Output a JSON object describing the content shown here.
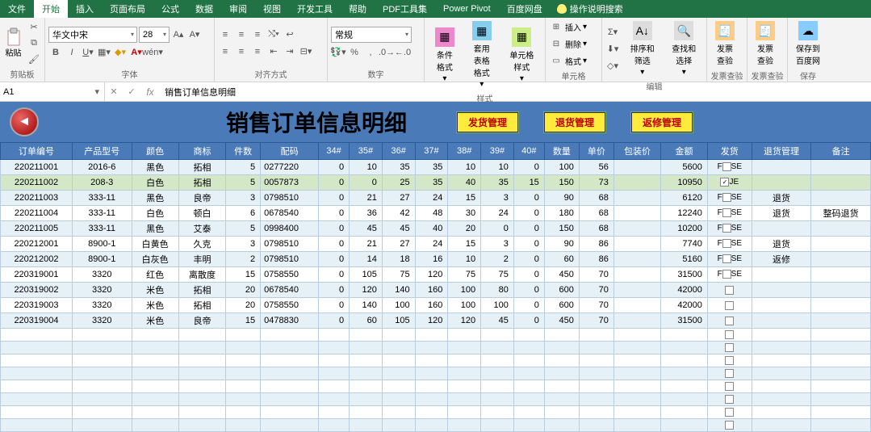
{
  "tabs": [
    "文件",
    "开始",
    "插入",
    "页面布局",
    "公式",
    "数据",
    "审阅",
    "视图",
    "开发工具",
    "帮助",
    "PDF工具集",
    "Power Pivot",
    "百度网盘"
  ],
  "active_tab": 1,
  "tellme": "操作说明搜索",
  "ribbon": {
    "clipboard": {
      "label": "剪贴板",
      "paste": "粘贴"
    },
    "font": {
      "label": "字体",
      "name": "华文中宋",
      "size": "28"
    },
    "align": {
      "label": "对齐方式"
    },
    "number": {
      "label": "数字",
      "format": "常规"
    },
    "styles": {
      "label": "样式",
      "cond": "条件格式",
      "table": "套用\n表格格式",
      "cell": "单元格样式"
    },
    "cells": {
      "label": "单元格",
      "insert": "插入",
      "delete": "删除",
      "format": "格式"
    },
    "editing": {
      "label": "编辑",
      "sort": "排序和筛选",
      "find": "查找和选择"
    },
    "fpcheck1": {
      "label": "发票查验",
      "btn": "发票\n查验"
    },
    "fpcheck2": {
      "label": "发票查验",
      "btn": "发票\n查验"
    },
    "save": {
      "label": "保存",
      "btn": "保存到\n百度网"
    }
  },
  "namebox": "A1",
  "formula": "销售订单信息明细",
  "title_big": "销售订单信息明细",
  "buttons": {
    "ship": "发货管理",
    "return": "退货管理",
    "repair": "返修管理"
  },
  "cols": [
    "订单编号",
    "产品型号",
    "颜色",
    "商标",
    "件数",
    "配码",
    "34#",
    "35#",
    "36#",
    "37#",
    "38#",
    "39#",
    "40#",
    "数量",
    "单价",
    "包装价",
    "金额",
    "发货",
    "退货管理",
    "备注"
  ],
  "selected_row_index": 1,
  "rows": [
    {
      "d": [
        "220211001",
        "2016-6",
        "黑色",
        "拓相",
        "5",
        "0277220",
        "0",
        "10",
        "35",
        "35",
        "10",
        "10",
        "0",
        "100",
        "56",
        "",
        "5600"
      ],
      "ship": "FALSE",
      "rg": "",
      "bz": ""
    },
    {
      "d": [
        "220211002",
        "208-3",
        "白色",
        "拓相",
        "5",
        "0057873",
        "0",
        "0",
        "25",
        "35",
        "40",
        "35",
        "15",
        "150",
        "73",
        "",
        "10950"
      ],
      "ship": "TRUE",
      "rg": "",
      "bz": ""
    },
    {
      "d": [
        "220211003",
        "333-11",
        "黑色",
        "良帝",
        "3",
        "0798510",
        "0",
        "21",
        "27",
        "24",
        "15",
        "3",
        "0",
        "90",
        "68",
        "",
        "6120"
      ],
      "ship": "FALSE",
      "rg": "退货",
      "bz": ""
    },
    {
      "d": [
        "220211004",
        "333-11",
        "白色",
        "顿白",
        "6",
        "0678540",
        "0",
        "36",
        "42",
        "48",
        "30",
        "24",
        "0",
        "180",
        "68",
        "",
        "12240"
      ],
      "ship": "FALSE",
      "rg": "退货",
      "bz": "整码退货"
    },
    {
      "d": [
        "220211005",
        "333-11",
        "黑色",
        "艾泰",
        "5",
        "0998400",
        "0",
        "45",
        "45",
        "40",
        "20",
        "0",
        "0",
        "150",
        "68",
        "",
        "10200"
      ],
      "ship": "FALSE",
      "rg": "",
      "bz": ""
    },
    {
      "d": [
        "220212001",
        "8900-1",
        "白黄色",
        "久克",
        "3",
        "0798510",
        "0",
        "21",
        "27",
        "24",
        "15",
        "3",
        "0",
        "90",
        "86",
        "",
        "7740"
      ],
      "ship": "FALSE",
      "rg": "退货",
      "bz": ""
    },
    {
      "d": [
        "220212002",
        "8900-1",
        "白灰色",
        "丰明",
        "2",
        "0798510",
        "0",
        "14",
        "18",
        "16",
        "10",
        "2",
        "0",
        "60",
        "86",
        "",
        "5160"
      ],
      "ship": "FALSE",
      "rg": "返修",
      "bz": ""
    },
    {
      "d": [
        "220319001",
        "3320",
        "红色",
        "离散度",
        "15",
        "0758550",
        "0",
        "105",
        "75",
        "120",
        "75",
        "75",
        "0",
        "450",
        "70",
        "",
        "31500"
      ],
      "ship": "FALSE",
      "rg": "",
      "bz": ""
    },
    {
      "d": [
        "220319002",
        "3320",
        "米色",
        "拓相",
        "20",
        "0678540",
        "0",
        "120",
        "140",
        "160",
        "100",
        "80",
        "0",
        "600",
        "70",
        "",
        "42000"
      ],
      "ship": "",
      "rg": "",
      "bz": ""
    },
    {
      "d": [
        "220319003",
        "3320",
        "米色",
        "拓相",
        "20",
        "0758550",
        "0",
        "140",
        "100",
        "160",
        "100",
        "100",
        "0",
        "600",
        "70",
        "",
        "42000"
      ],
      "ship": "",
      "rg": "",
      "bz": ""
    },
    {
      "d": [
        "220319004",
        "3320",
        "米色",
        "良帝",
        "15",
        "0478830",
        "0",
        "60",
        "105",
        "120",
        "120",
        "45",
        "0",
        "450",
        "70",
        "",
        "31500"
      ],
      "ship": "",
      "rg": "",
      "bz": ""
    }
  ],
  "empty_rows": 8
}
